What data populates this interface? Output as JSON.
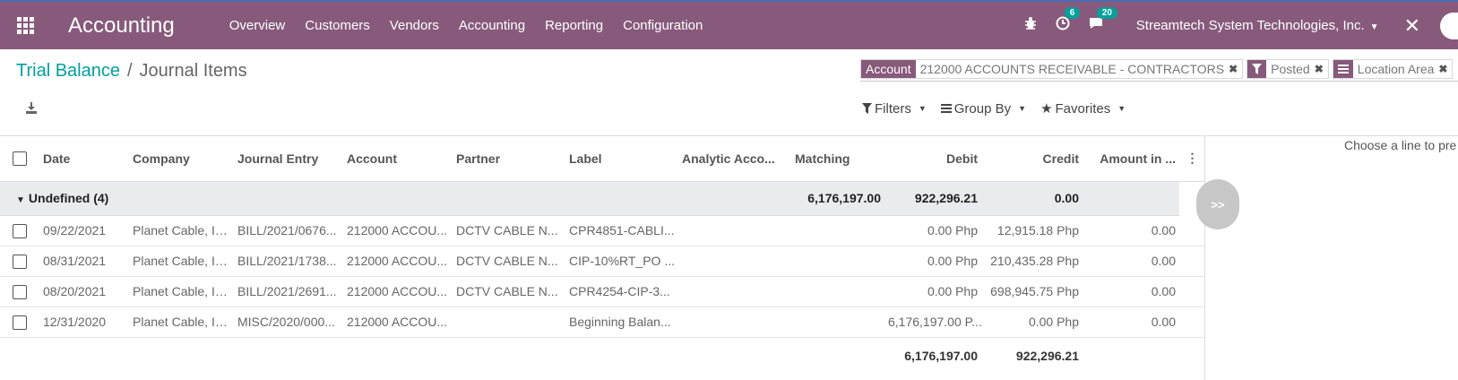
{
  "navbar": {
    "app_title": "Accounting",
    "menu": [
      "Overview",
      "Customers",
      "Vendors",
      "Accounting",
      "Reporting",
      "Configuration"
    ],
    "bug_icon": "bug-icon",
    "activity_badge": "6",
    "messages_badge": "20",
    "company": "Streamtech System Technologies, Inc.",
    "color": "#875a7b"
  },
  "breadcrumb": {
    "parent": "Trial Balance",
    "separator": "/",
    "current": "Journal Items"
  },
  "search": {
    "facets": [
      {
        "label": "Account",
        "value": "212000 ACCOUNTS RECEIVABLE - CONTRACTORS",
        "icon": null
      },
      {
        "label": "",
        "value": "Posted",
        "icon": "filter-icon"
      },
      {
        "label": "",
        "value": "Location Area",
        "icon": "group-icon"
      }
    ],
    "input_stub": "S"
  },
  "controls": {
    "filters": "Filters",
    "group_by": "Group By",
    "favorites": "Favorites"
  },
  "table": {
    "columns": [
      "Date",
      "Company",
      "Journal Entry",
      "Account",
      "Partner",
      "Label",
      "Analytic Acco...",
      "Matching",
      "Debit",
      "Credit",
      "Amount in ..."
    ],
    "group": {
      "label": "Undefined (4)",
      "debit": "6,176,197.00",
      "credit": "922,296.21",
      "amount": "0.00"
    },
    "rows": [
      {
        "date": "09/22/2021",
        "company": "Planet Cable, Inc.",
        "entry": "BILL/2021/0676...",
        "account": "212000 ACCOU...",
        "partner": "DCTV CABLE N...",
        "label": "CPR4851-CABLI...",
        "analytic": "",
        "matching": "",
        "debit": "0.00 Php",
        "credit": "12,915.18 Php",
        "amount": "0.00"
      },
      {
        "date": "08/31/2021",
        "company": "Planet Cable, Inc.",
        "entry": "BILL/2021/1738...",
        "account": "212000 ACCOU...",
        "partner": "DCTV CABLE N...",
        "label": "CIP-10%RT_PO ...",
        "analytic": "",
        "matching": "",
        "debit": "0.00 Php",
        "credit": "210,435.28 Php",
        "amount": "0.00"
      },
      {
        "date": "08/20/2021",
        "company": "Planet Cable, Inc.",
        "entry": "BILL/2021/2691...",
        "account": "212000 ACCOU...",
        "partner": "DCTV CABLE N...",
        "label": "CPR4254-CIP-3...",
        "analytic": "",
        "matching": "",
        "debit": "0.00 Php",
        "credit": "698,945.75 Php",
        "amount": "0.00"
      },
      {
        "date": "12/31/2020",
        "company": "Planet Cable, Inc.",
        "entry": "MISC/2020/000...",
        "account": "212000 ACCOU...",
        "partner": "",
        "label": "Beginning Balan...",
        "analytic": "",
        "matching": "",
        "debit": "6,176,197.00 P...",
        "credit": "0.00 Php",
        "amount": "0.00"
      }
    ],
    "totals": {
      "debit": "6,176,197.00",
      "credit": "922,296.21"
    }
  },
  "preview": {
    "hint": "Choose a line to pre",
    "expand_label": ">>"
  }
}
